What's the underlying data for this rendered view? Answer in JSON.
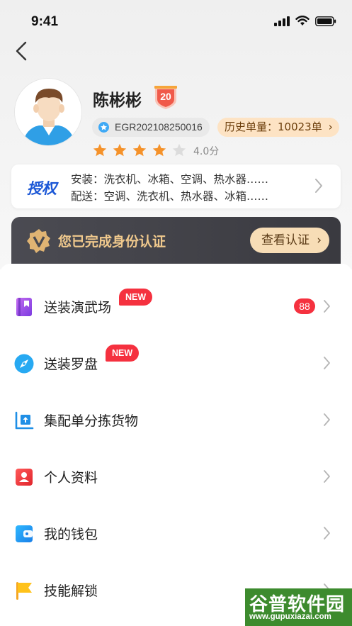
{
  "status_bar": {
    "time": "9:41"
  },
  "profile": {
    "name": "陈彬彬",
    "level": "20",
    "id_code": "EGR202108250016",
    "history_orders": "历史单量：10023单",
    "stars_filled": 4,
    "stars_total": 5,
    "rating": "4.0分"
  },
  "authorization": {
    "title": "授权",
    "install_line": "安装：洗衣机、冰箱、空调、热水器……",
    "delivery_line": "配送：空调、洗衣机、热水器、冰箱……"
  },
  "verification": {
    "message": "您已完成身份认证",
    "button_label": "查看认证"
  },
  "menu": {
    "items": [
      {
        "label": "送装演武场",
        "badge": "NEW",
        "count": "88"
      },
      {
        "label": "送装罗盘",
        "badge": "NEW"
      },
      {
        "label": "集配单分拣货物"
      },
      {
        "label": "个人资料"
      },
      {
        "label": "我的钱包"
      },
      {
        "label": "技能解锁"
      }
    ]
  },
  "watermark": {
    "title": "谷普软件园",
    "url": "www.gupuxiazai.com"
  },
  "colors": {
    "accent_blue": "#1b57d6",
    "badge_red": "#f5313f",
    "gold": "#f0c98d",
    "star_orange": "#f5922a"
  }
}
